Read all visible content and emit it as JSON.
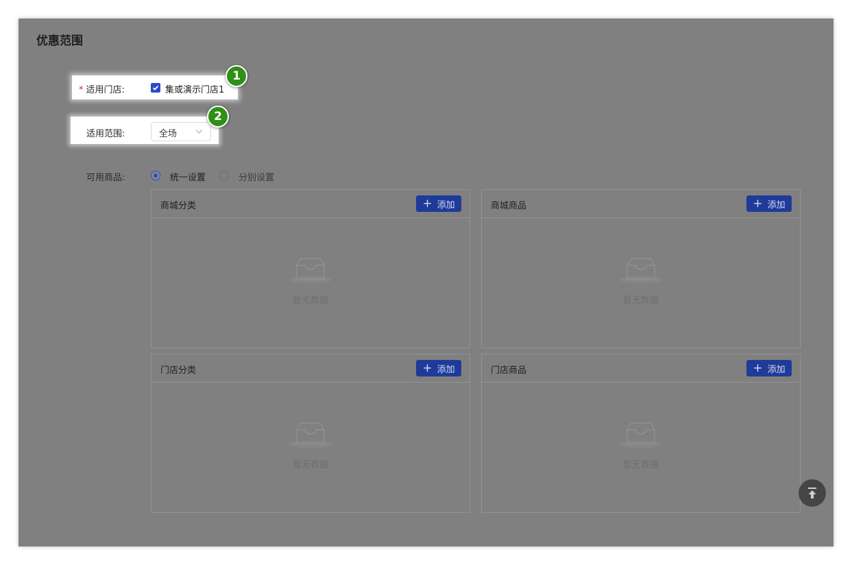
{
  "section": {
    "title": "优惠范围"
  },
  "store": {
    "required_mark": "*",
    "label": "适用门店:",
    "checked": true,
    "option": "集或演示门店1",
    "badge": "1"
  },
  "scope": {
    "label": "适用范围:",
    "value": "全场",
    "badge": "2"
  },
  "goods": {
    "label": "可用商品:",
    "radio_options": [
      {
        "label": "统一设置",
        "selected": true
      },
      {
        "label": "分别设置",
        "selected": false
      }
    ]
  },
  "cards": [
    {
      "title": "商城分类",
      "button": "添加",
      "empty": "暂无数据"
    },
    {
      "title": "商城商品",
      "button": "添加",
      "empty": "暂无数据"
    },
    {
      "title": "门店分类",
      "button": "添加",
      "empty": "暂无数据"
    },
    {
      "title": "门店商品",
      "button": "添加",
      "empty": "暂无数据"
    }
  ],
  "colors": {
    "accent": "#2b4bc8",
    "button": "#1f3a99",
    "badge": "#2f8f16",
    "overlay": "#808080"
  },
  "icons": {
    "checkbox": "check-icon",
    "select": "chevron-down-icon",
    "empty": "inbox-icon",
    "back_to_top": "arrow-up-to-line-icon"
  }
}
